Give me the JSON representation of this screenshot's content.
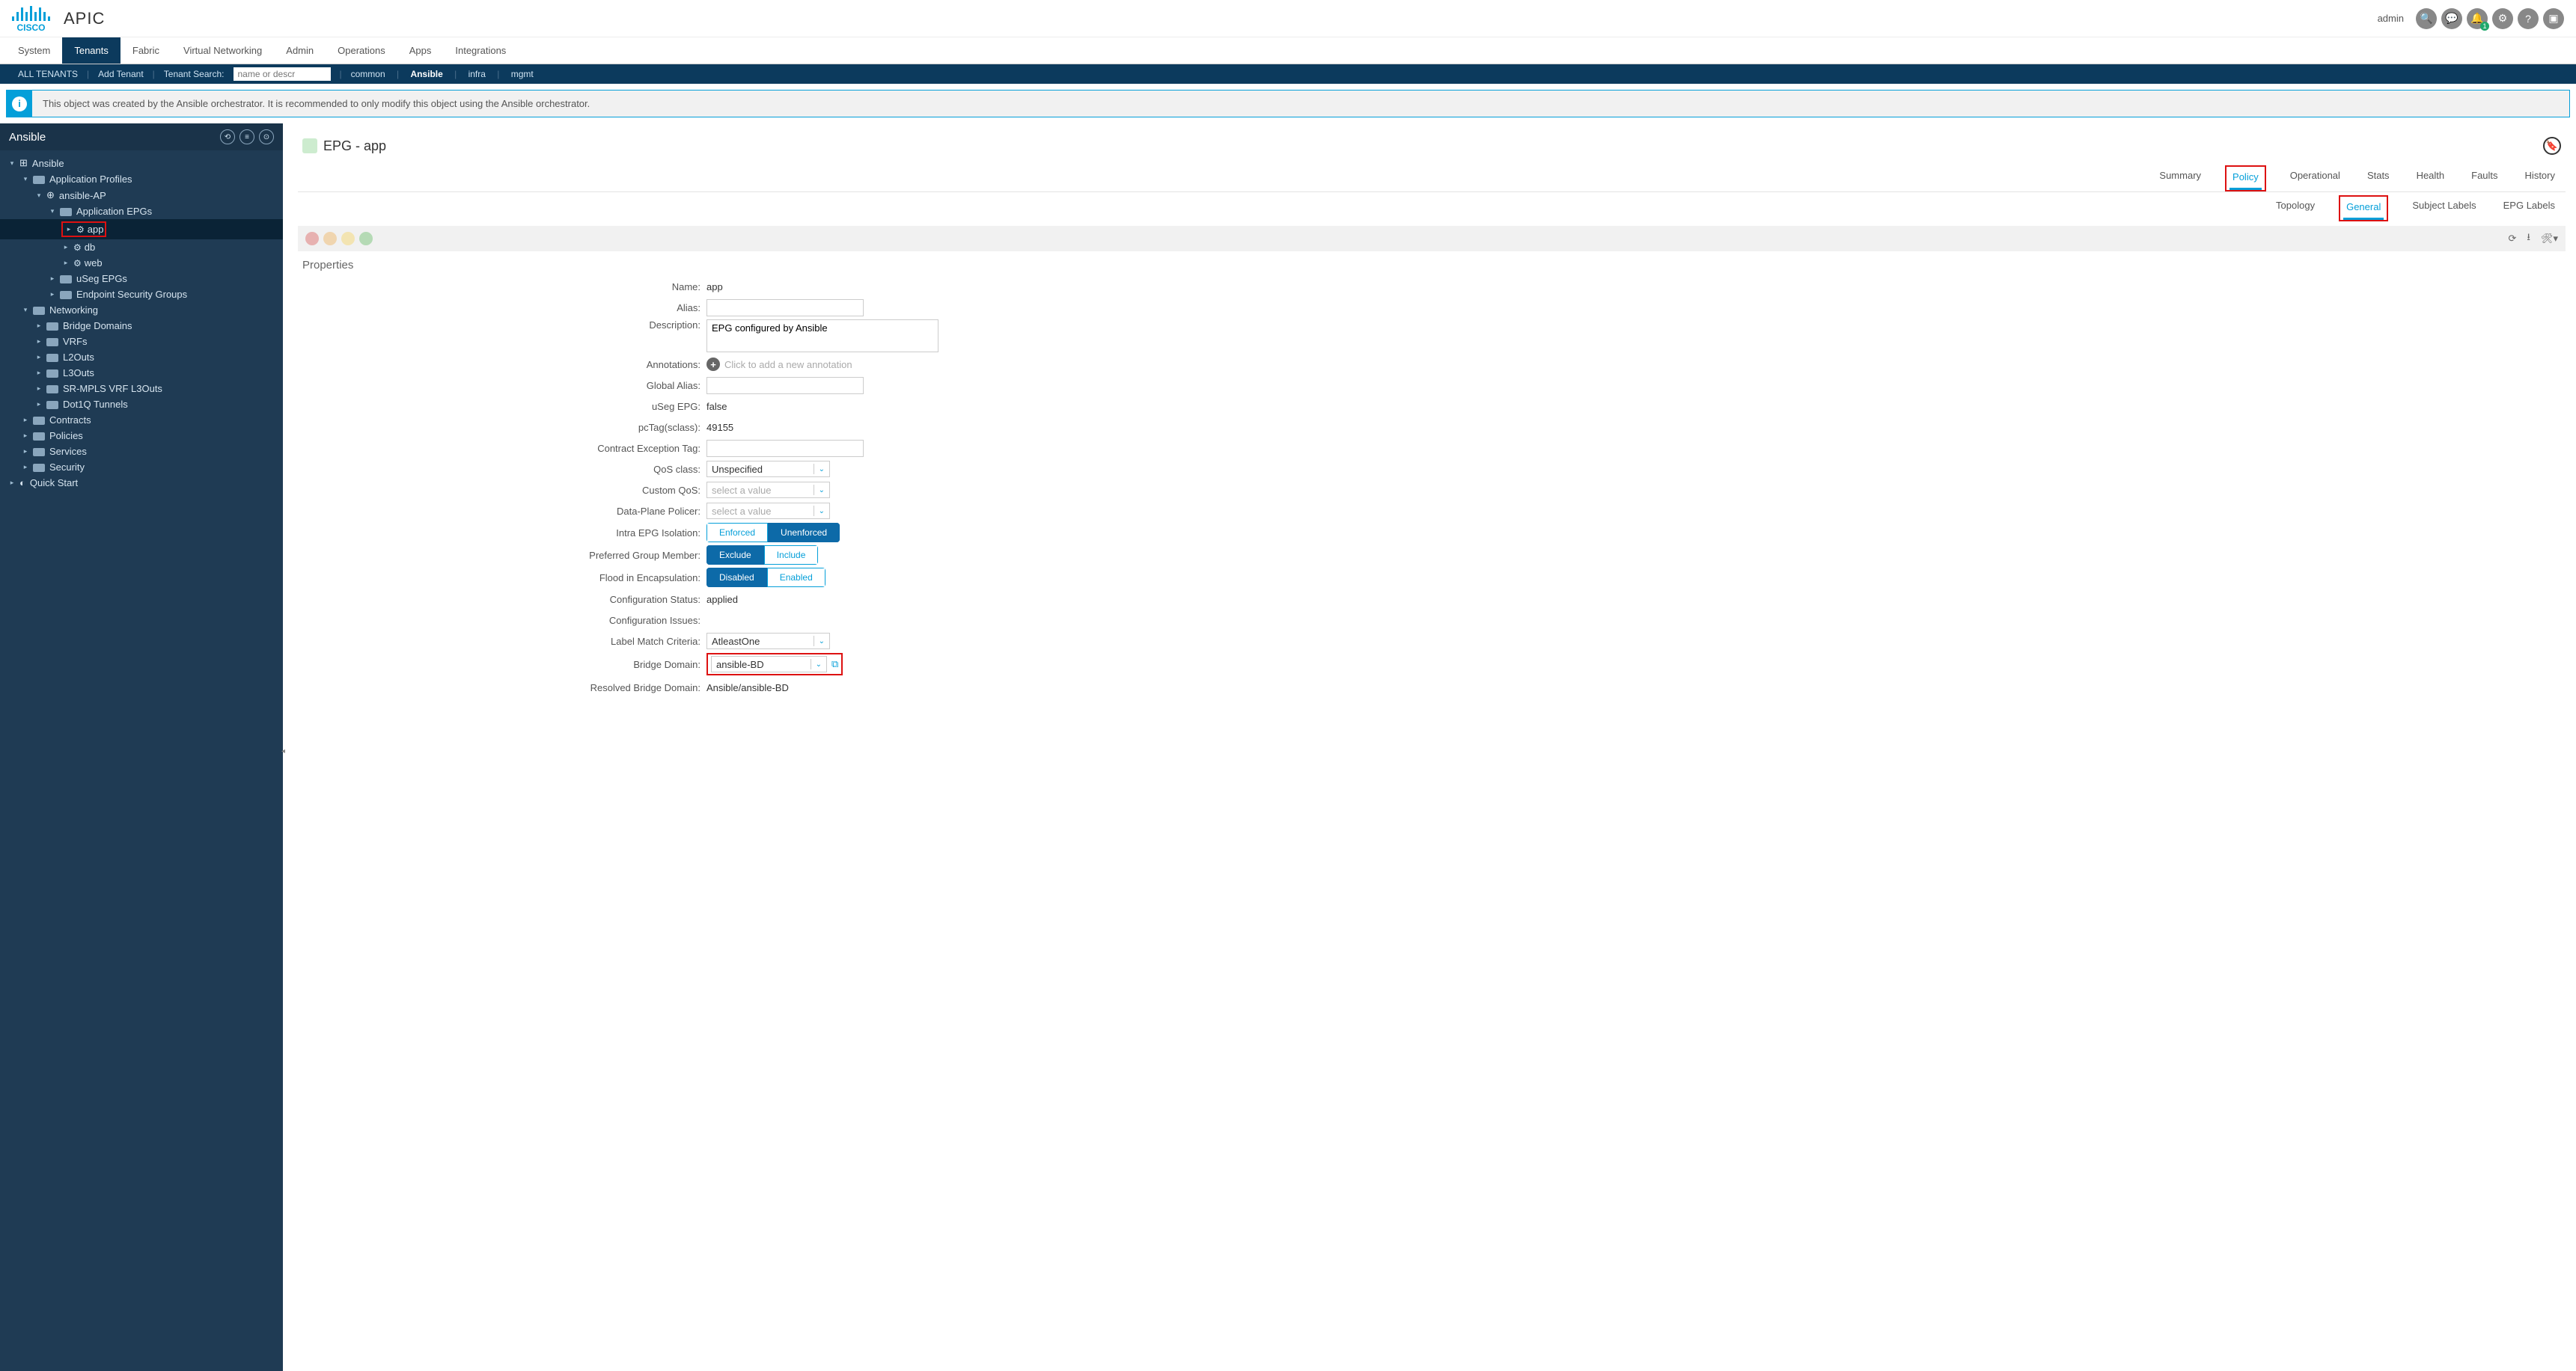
{
  "header": {
    "brand": "CISCO",
    "app": "APIC",
    "user": "admin"
  },
  "nav": [
    "System",
    "Tenants",
    "Fabric",
    "Virtual Networking",
    "Admin",
    "Operations",
    "Apps",
    "Integrations"
  ],
  "nav_active": "Tenants",
  "subnav": {
    "all": "ALL TENANTS",
    "add": "Add Tenant",
    "search_label": "Tenant Search:",
    "search_placeholder": "name or descr",
    "links": [
      "common",
      "Ansible",
      "infra",
      "mgmt"
    ],
    "bold": "Ansible"
  },
  "banner": "This object was created by the Ansible orchestrator. It is recommended to only modify this object using the Ansible orchestrator.",
  "sidebar": {
    "title": "Ansible",
    "tree": [
      {
        "d": 0,
        "c": "▾",
        "i": "grid",
        "t": "Ansible"
      },
      {
        "d": 1,
        "c": "▾",
        "i": "folder",
        "t": "Application Profiles"
      },
      {
        "d": 2,
        "c": "▾",
        "i": "ap",
        "t": "ansible-AP"
      },
      {
        "d": 3,
        "c": "▾",
        "i": "folder",
        "t": "Application EPGs"
      },
      {
        "d": 4,
        "c": "▸",
        "i": "epg",
        "t": "app",
        "sel": true,
        "red": true
      },
      {
        "d": 4,
        "c": "▸",
        "i": "epg",
        "t": "db"
      },
      {
        "d": 4,
        "c": "▸",
        "i": "epg",
        "t": "web"
      },
      {
        "d": 3,
        "c": "▸",
        "i": "folder",
        "t": "uSeg EPGs"
      },
      {
        "d": 3,
        "c": "▸",
        "i": "folder",
        "t": "Endpoint Security Groups"
      },
      {
        "d": 1,
        "c": "▾",
        "i": "folder",
        "t": "Networking"
      },
      {
        "d": 2,
        "c": "▸",
        "i": "folder",
        "t": "Bridge Domains"
      },
      {
        "d": 2,
        "c": "▸",
        "i": "folder",
        "t": "VRFs"
      },
      {
        "d": 2,
        "c": "▸",
        "i": "folder",
        "t": "L2Outs"
      },
      {
        "d": 2,
        "c": "▸",
        "i": "folder",
        "t": "L3Outs"
      },
      {
        "d": 2,
        "c": "▸",
        "i": "folder",
        "t": "SR-MPLS VRF L3Outs"
      },
      {
        "d": 2,
        "c": "▸",
        "i": "folder",
        "t": "Dot1Q Tunnels"
      },
      {
        "d": 1,
        "c": "▸",
        "i": "folder",
        "t": "Contracts"
      },
      {
        "d": 1,
        "c": "▸",
        "i": "folder",
        "t": "Policies"
      },
      {
        "d": 1,
        "c": "▸",
        "i": "folder",
        "t": "Services"
      },
      {
        "d": 1,
        "c": "▸",
        "i": "folder",
        "t": "Security"
      },
      {
        "d": 0,
        "c": "▸",
        "i": "quick",
        "t": "Quick Start"
      }
    ]
  },
  "page": {
    "title": "EPG - app",
    "tabs1": [
      "Summary",
      "Policy",
      "Operational",
      "Stats",
      "Health",
      "Faults",
      "History"
    ],
    "tabs1_active": "Policy",
    "tabs2": [
      "Topology",
      "General",
      "Subject Labels",
      "EPG Labels"
    ],
    "tabs2_active": "General"
  },
  "props": {
    "heading": "Properties",
    "labels": {
      "name": "Name:",
      "alias": "Alias:",
      "desc": "Description:",
      "ann": "Annotations:",
      "galias": "Global Alias:",
      "useg": "uSeg EPG:",
      "pctag": "pcTag(sclass):",
      "cet": "Contract Exception Tag:",
      "qos": "QoS class:",
      "cqos": "Custom QoS:",
      "dpp": "Data-Plane Policer:",
      "iso": "Intra EPG Isolation:",
      "pgm": "Preferred Group Member:",
      "flood": "Flood in Encapsulation:",
      "cstat": "Configuration Status:",
      "cissue": "Configuration Issues:",
      "lmc": "Label Match Criteria:",
      "bd": "Bridge Domain:",
      "rbd": "Resolved Bridge Domain:"
    },
    "values": {
      "name": "app",
      "desc": "EPG configured by Ansible",
      "ann_ph": "Click to add a new annotation",
      "useg": "false",
      "pctag": "49155",
      "qos": "Unspecified",
      "cqos_ph": "select a value",
      "dpp_ph": "select a value",
      "cstat": "applied",
      "lmc": "AtleastOne",
      "bd": "ansible-BD",
      "rbd": "Ansible/ansible-BD"
    },
    "toggles": {
      "iso": {
        "a": "Enforced",
        "b": "Unenforced",
        "active": "b"
      },
      "pgm": {
        "a": "Exclude",
        "b": "Include",
        "active": "a"
      },
      "flood": {
        "a": "Disabled",
        "b": "Enabled",
        "active": "a"
      }
    }
  }
}
